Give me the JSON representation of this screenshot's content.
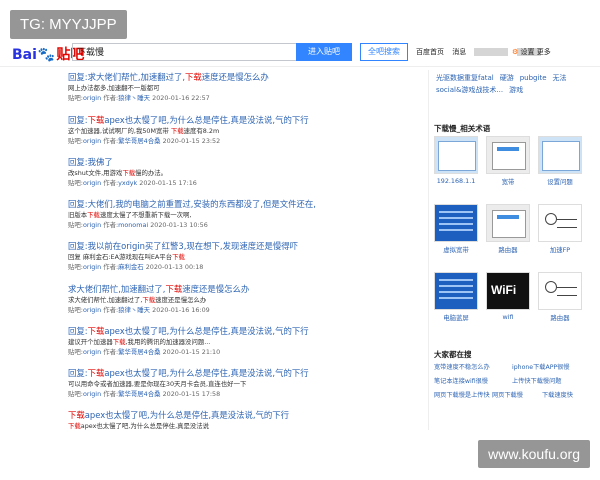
{
  "watermarks": {
    "top": "TG: MYYJJPP",
    "bottom": "www.koufu.org"
  },
  "header": {
    "logo_left": "Bai",
    "logo_paw": "🐾",
    "logo_right": "贴吧",
    "search_value": "下载慢",
    "enter_button": "进入贴吧",
    "search_button": "全吧搜索",
    "links": [
      "百度首页",
      "消息"
    ],
    "settings": "设置",
    "more": "更多"
  },
  "posts": [
    {
      "title_pre": "回复:求大佬们帮忙,加速翻过了,",
      "title_hl": "下载",
      "title_post": "速度还是慢怎么办",
      "abstract_pre": "网上办法都多,加速翻不一版都可",
      "abstract_hl": "",
      "abstract_post": "",
      "forum": "origin",
      "author": "狼律丶睡天",
      "date": "2020-01-16 22:57"
    },
    {
      "title_pre": "回复:",
      "title_hl": "下载",
      "title_post": "apex也太慢了吧,为什么总是停住,真是没法说,气的下行",
      "abstract_pre": "这个加速器,试试啊厂的,我50M宽带 ",
      "abstract_hl": "下载",
      "abstract_post": "速度有8.2m",
      "forum": "origin",
      "author": "繁华哥居4合桑",
      "date": "2020-01-15 23:52"
    },
    {
      "title_pre": "回复:我佛了",
      "title_hl": "",
      "title_post": "",
      "abstract_pre": "改shut文件,用游戏",
      "abstract_hl": "下载",
      "abstract_post": "慢的办法。",
      "forum": "origin",
      "author": "yxdyk",
      "date": "2020-01-15 17:16"
    },
    {
      "title_pre": "回复:大佬们,我的电脑之前重置过,安装的东西都没了,但是文件还在,",
      "title_hl": "",
      "title_post": "",
      "abstract_pre": "旧版本",
      "abstract_hl": "下载",
      "abstract_post": "速度太慢了不想重新下载一次啊,",
      "forum": "origin",
      "author": "monomai",
      "date": "2020-01-13 10:56"
    },
    {
      "title_pre": "回复:我以前在origin买了红警3,现在想下,发现速度还是慢得吓",
      "title_hl": "",
      "title_post": "",
      "abstract_pre": "回复 麻利金石:EA游戏现在叫EA平台",
      "abstract_hl": "下载",
      "abstract_post": "",
      "forum": "origin",
      "author": "麻利金石",
      "date": "2020-01-13 00:18"
    },
    {
      "title_pre": "求大佬们帮忙,加速翻过了,",
      "title_hl": "下载",
      "title_post": "速度还是慢怎么办",
      "abstract_pre": "求大佬们帮忙,加速翻过了,",
      "abstract_hl": "下载",
      "abstract_post": "速度还是慢怎么办",
      "forum": "origin",
      "author": "狼律丶睡天",
      "date": "2020-01-16 16:09"
    },
    {
      "title_pre": "回复:",
      "title_hl": "下载",
      "title_post": "apex也太慢了吧,为什么总是停住,真是没法说,气的下行",
      "abstract_pre": "建议开个加速器",
      "abstract_hl": "下载",
      "abstract_post": ",我用的腾讯的加速器没问题...",
      "forum": "origin",
      "author": "繁华哥居4合桑",
      "date": "2020-01-15 21:10"
    },
    {
      "title_pre": "回复:",
      "title_hl": "下载",
      "title_post": "apex也太慢了吧,为什么总是停住,真是没法说,气的下行",
      "abstract_pre": "可以用命令或者加速器,要是你现在30天月卡会员,直连也好一下",
      "abstract_hl": "",
      "abstract_post": "",
      "forum": "origin",
      "author": "繁华哥居4合桑",
      "date": "2020-01-15 17:58"
    },
    {
      "title_pre": "",
      "title_hl": "下载",
      "title_post": "apex也太慢了吧,为什么总是停住,真是没法说,气的下行",
      "abstract_pre": "",
      "abstract_hl": "下载",
      "abstract_post": "apex也太慢了吧,为什么总是停住,真是没法说",
      "forum": "",
      "author": "",
      "date": ""
    }
  ],
  "labels": {
    "forum_prefix": "贴吧:",
    "author_prefix": "作者:"
  },
  "right": {
    "related_top": [
      "光驱数据重复fatal",
      "硬游",
      "pubgite",
      "无法",
      "social&游戏战技术...",
      "游戏"
    ],
    "images_title": "下载慢_相关术语",
    "thumbs": [
      {
        "cap": "192.168.1.1",
        "style": "win"
      },
      {
        "cap": "宽带",
        "style": "win2"
      },
      {
        "cap": "设置问题",
        "style": "win"
      },
      {
        "cap": "虚拟宽带",
        "style": "blue"
      },
      {
        "cap": "路由器",
        "style": "win2"
      },
      {
        "cap": "加速FP",
        "style": "diagram"
      },
      {
        "cap": "电脑蓝屏",
        "style": "blue"
      },
      {
        "cap": "wifi",
        "style": "wifi"
      },
      {
        "cap": "路由器",
        "style": "diagram"
      }
    ],
    "hot_title": "大家都在搜",
    "hot": [
      [
        "宽带速度不稳怎么办",
        "iphone下载APP很慢"
      ],
      [
        "笔记本连接wifi很慢",
        "上传快下载慢问题"
      ],
      [
        "网页下载慢是上传快",
        "网页下载慢",
        "下载速度快"
      ]
    ]
  }
}
